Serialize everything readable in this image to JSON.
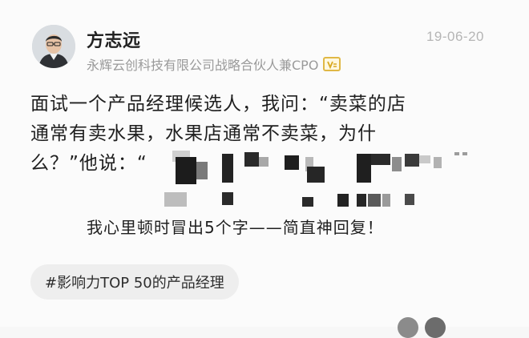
{
  "post": {
    "author": {
      "name": "方志远",
      "title": "永辉云创科技有限公司战略合伙人兼CPO",
      "verified_badge_icon": "verified-v-badge-icon"
    },
    "date": "19-06-20",
    "content": {
      "line1": "面试一个产品经理候选人，我问：“卖菜的店",
      "line2": "通常有卖水果，水果店通常不卖菜，为什",
      "line3_prefix": "么？”他说：“",
      "line4_suffix": "",
      "reply": "我心里顿时冒出5个字——简直神回复！"
    },
    "tag": "#影响力TOP 50的产品经理"
  },
  "colors": {
    "background": "#fbfbfb",
    "text": "#1f1f1f",
    "muted": "#9a9a9a",
    "date": "#b5b5b5",
    "badge": "#e0b845",
    "tag_bg": "#eeeeee"
  }
}
